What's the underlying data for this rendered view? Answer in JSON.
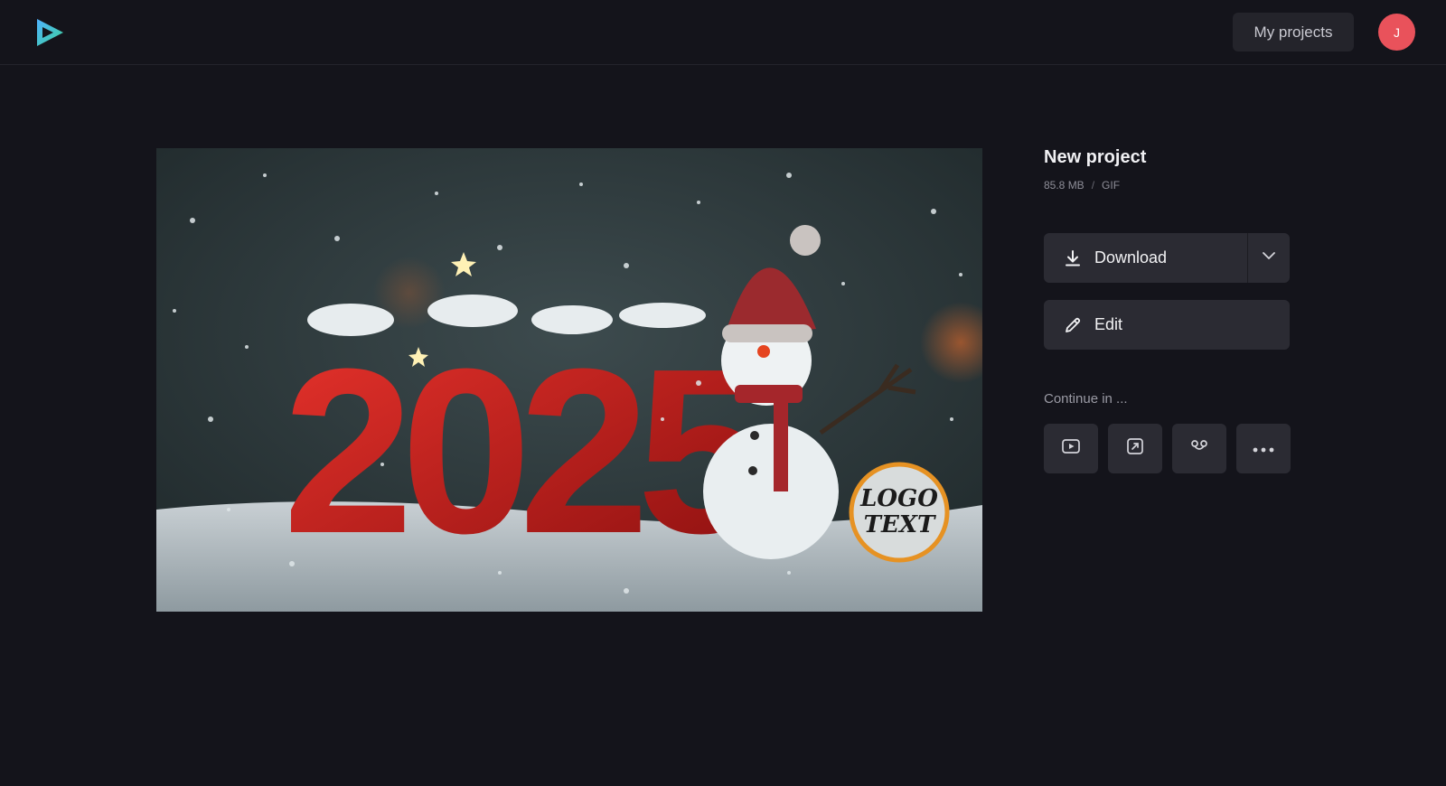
{
  "header": {
    "logo_icon": "play-triangle-logo-icon",
    "my_projects_label": "My projects",
    "avatar_initial": "J",
    "avatar_color": "#e9525b"
  },
  "preview": {
    "logo_text_line1": "LOGO",
    "logo_text_line2": "TEXT",
    "headline_digits": "2025"
  },
  "project": {
    "title": "New project",
    "size": "85.8 MB",
    "separator": "/",
    "format": "GIF"
  },
  "actions": {
    "download_label": "Download",
    "download_icon": "download-icon",
    "dropdown_icon": "chevron-down-icon",
    "edit_label": "Edit",
    "edit_icon": "pencil-icon"
  },
  "continue": {
    "label": "Continue in ...",
    "options": [
      {
        "icon": "youtube-play-icon"
      },
      {
        "icon": "resize-frame-icon"
      },
      {
        "icon": "linked-nodes-icon"
      },
      {
        "icon": "more-dots-icon"
      }
    ]
  }
}
